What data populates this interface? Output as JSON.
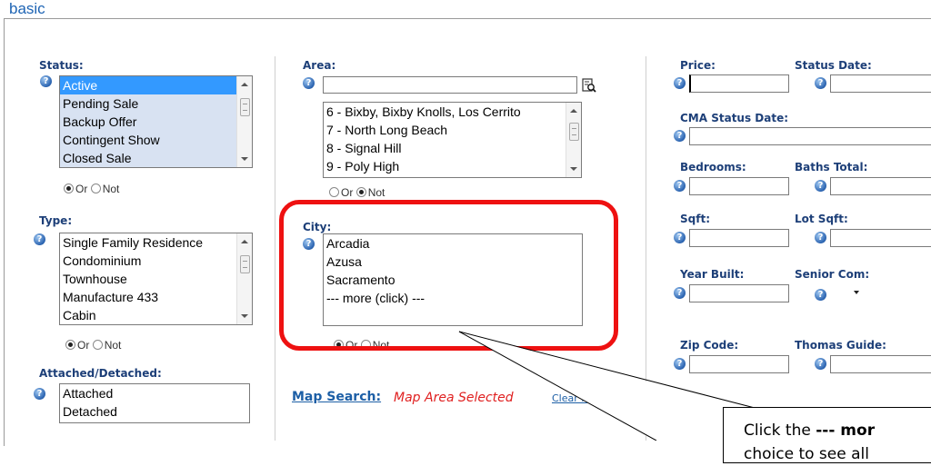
{
  "section": {
    "title": "basic"
  },
  "status": {
    "label": "Status:",
    "options": [
      "Active",
      "Pending Sale",
      "Backup Offer",
      "Contingent Show",
      "Closed Sale"
    ],
    "selected_index": 0,
    "or_label": "Or",
    "not_label": "Not"
  },
  "type": {
    "label": "Type:",
    "options": [
      "Single Family Residence",
      "Condominium",
      "Townhouse",
      "Manufacture 433",
      "Cabin"
    ],
    "or_label": "Or",
    "not_label": "Not"
  },
  "attached": {
    "label": "Attached/Detached:",
    "options": [
      "Attached",
      "Detached"
    ]
  },
  "area": {
    "label": "Area:",
    "value": "",
    "options": [
      "6 - Bixby, Bixby Knolls, Los Cerrito",
      "7 - North Long Beach",
      "8 - Signal Hill",
      "9 - Poly High"
    ],
    "or_label": "Or",
    "not_label": "Not"
  },
  "city": {
    "label": "City:",
    "options": [
      "Arcadia",
      "Azusa",
      "Sacramento",
      "--- more (click) ---"
    ],
    "or_label": "Or",
    "not_label": "Not"
  },
  "map": {
    "link": "Map Search:",
    "status": "Map Area Selected",
    "clear": "Clear Map"
  },
  "right": {
    "price": "Price:",
    "status_date": "Status Date:",
    "cma_status_date": "CMA Status Date:",
    "bedrooms": "Bedrooms:",
    "baths_total": "Baths Total:",
    "sqft": "Sqft:",
    "lot_sqft": "Lot Sqft:",
    "year_built": "Year Built:",
    "senior_com": "Senior Com:",
    "zip_code": "Zip Code:",
    "thomas_guide": "Thomas Guide:"
  },
  "callout": {
    "prefix": "Click the ",
    "bold": "--- mor",
    "line2": "choice to see all"
  },
  "colors": {
    "accent": "#1e64b4",
    "label": "#1d3f78",
    "highlight": "#ee1111",
    "selection": "#3399ff",
    "map_status": "#e02020"
  }
}
